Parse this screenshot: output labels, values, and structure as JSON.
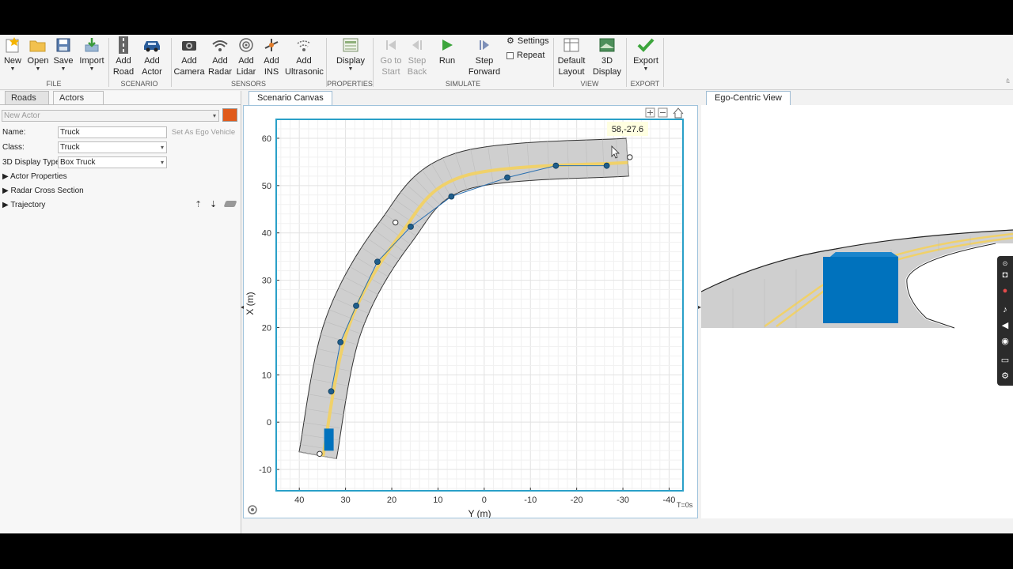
{
  "toolstrip": {
    "file": {
      "section": "FILE",
      "new": "New",
      "open": "Open",
      "save": "Save",
      "import": "Import"
    },
    "scenario": {
      "section": "SCENARIO",
      "add_road": "Add\nRoad",
      "add_actor": "Add\nActor"
    },
    "sensors": {
      "section": "SENSORS",
      "add_camera": "Add\nCamera",
      "add_radar": "Add\nRadar",
      "add_lidar": "Add\nLidar",
      "add_ins": "Add\nINS",
      "add_ultrasonic": "Add\nUltrasonic"
    },
    "properties": {
      "section": "PROPERTIES",
      "display": "Display"
    },
    "simulate": {
      "section": "SIMULATE",
      "go_to_start": "Go to\nStart",
      "step_back": "Step\nBack",
      "run": "Run",
      "step_forward": "Step\nForward",
      "settings": "Settings",
      "repeat": "Repeat"
    },
    "view": {
      "section": "VIEW",
      "default_layout": "Default\nLayout",
      "display_3d": "3D\nDisplay"
    },
    "export": {
      "section": "EXPORT",
      "export": "Export"
    }
  },
  "left_panel": {
    "tabs": {
      "roads": "Roads",
      "actors": "Actors"
    },
    "actor_select": "New Actor",
    "actor_color": "#e05a1a",
    "name_label": "Name:",
    "name_value": "Truck",
    "set_ego_button": "Set As Ego Vehicle",
    "class_label": "Class:",
    "class_value": "Truck",
    "display_type_label": "3D Display Type:",
    "display_type_value": "Box Truck",
    "sections": {
      "actor_properties": "Actor Properties",
      "radar_cross_section": "Radar Cross Section",
      "trajectory": "Trajectory"
    }
  },
  "canvas": {
    "tab_label": "Scenario Canvas",
    "cursor_readout": "58,-27.6",
    "time_label": "T=0s",
    "xlabel": "Y (m)",
    "ylabel": "X (m)",
    "x_ticks": [
      "40",
      "30",
      "20",
      "10",
      "0",
      "-10",
      "-20",
      "-30",
      "-40"
    ],
    "y_ticks": [
      "60",
      "50",
      "40",
      "30",
      "20",
      "10",
      "0",
      "-10"
    ]
  },
  "ego_view": {
    "tab_label": "Ego-Centric View"
  },
  "scenario_data": {
    "road_centerline": [
      [
        -7,
        36
      ],
      [
        20,
        30.6
      ],
      [
        40,
        19.3
      ],
      [
        53,
        5
      ],
      [
        56,
        -31
      ]
    ],
    "waypoints": [
      [
        6.5,
        33.1
      ],
      [
        16.9,
        31.1
      ],
      [
        24.6,
        27.7
      ],
      [
        33.9,
        23.1
      ],
      [
        41.3,
        15.9
      ],
      [
        47.7,
        7.1
      ],
      [
        51.7,
        -5
      ],
      [
        54.2,
        -15.5
      ],
      [
        54.2,
        -26.5
      ]
    ],
    "road_control_points": [
      [
        -6.7,
        35.6
      ],
      [
        42.2,
        19.2
      ],
      [
        56,
        -31.5
      ]
    ],
    "actor_position": [
      -3.7,
      33.6
    ],
    "colors": {
      "road": "#cfcfcf",
      "lane_marking": "#f0d16a",
      "trajectory": "#2a6fb0",
      "waypoint": "#1f5e8c",
      "actor": "#0072bd",
      "axes_border": "#2aa0c8"
    }
  }
}
